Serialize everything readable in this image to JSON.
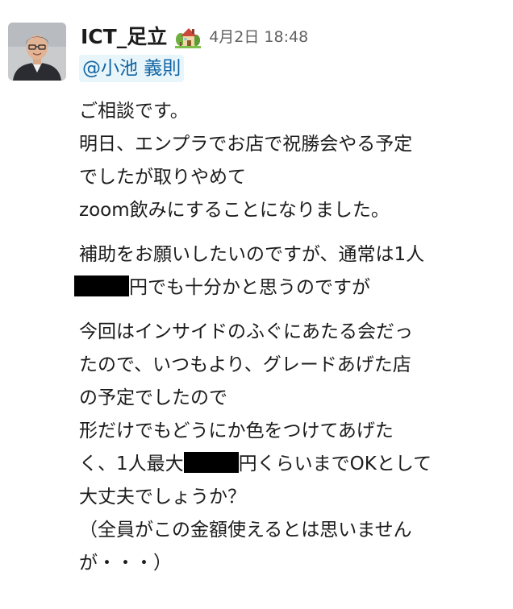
{
  "message": {
    "sender": "ICT_足立",
    "status_emoji_icon": "house-with-garden-icon",
    "timestamp": "4月2日 18:48",
    "mention": "@小池 義則",
    "paragraphs": [
      {
        "lines": [
          "ご相談です。",
          "明日、エンプラでお店で祝勝会やる予定",
          "でしたが取りやめて",
          "zoom飲みにすることになりました。"
        ]
      },
      {
        "lines": [
          "補助をお願いしたいのですが、通常は1人",
          "円でも十分かと思うのですが"
        ]
      },
      {
        "lines": [
          "今回はインサイドのふぐにあたる会だっ",
          "たので、いつもより、グレードあげた店",
          "の予定でしたので",
          "形だけでもどうにか色をつけてあげた",
          "く、1人最大",
          "円くらいまでOKとして",
          "大丈夫でしょうか？",
          "（全員がこの金額使えるとは思いません",
          "が・・・）"
        ]
      }
    ]
  }
}
